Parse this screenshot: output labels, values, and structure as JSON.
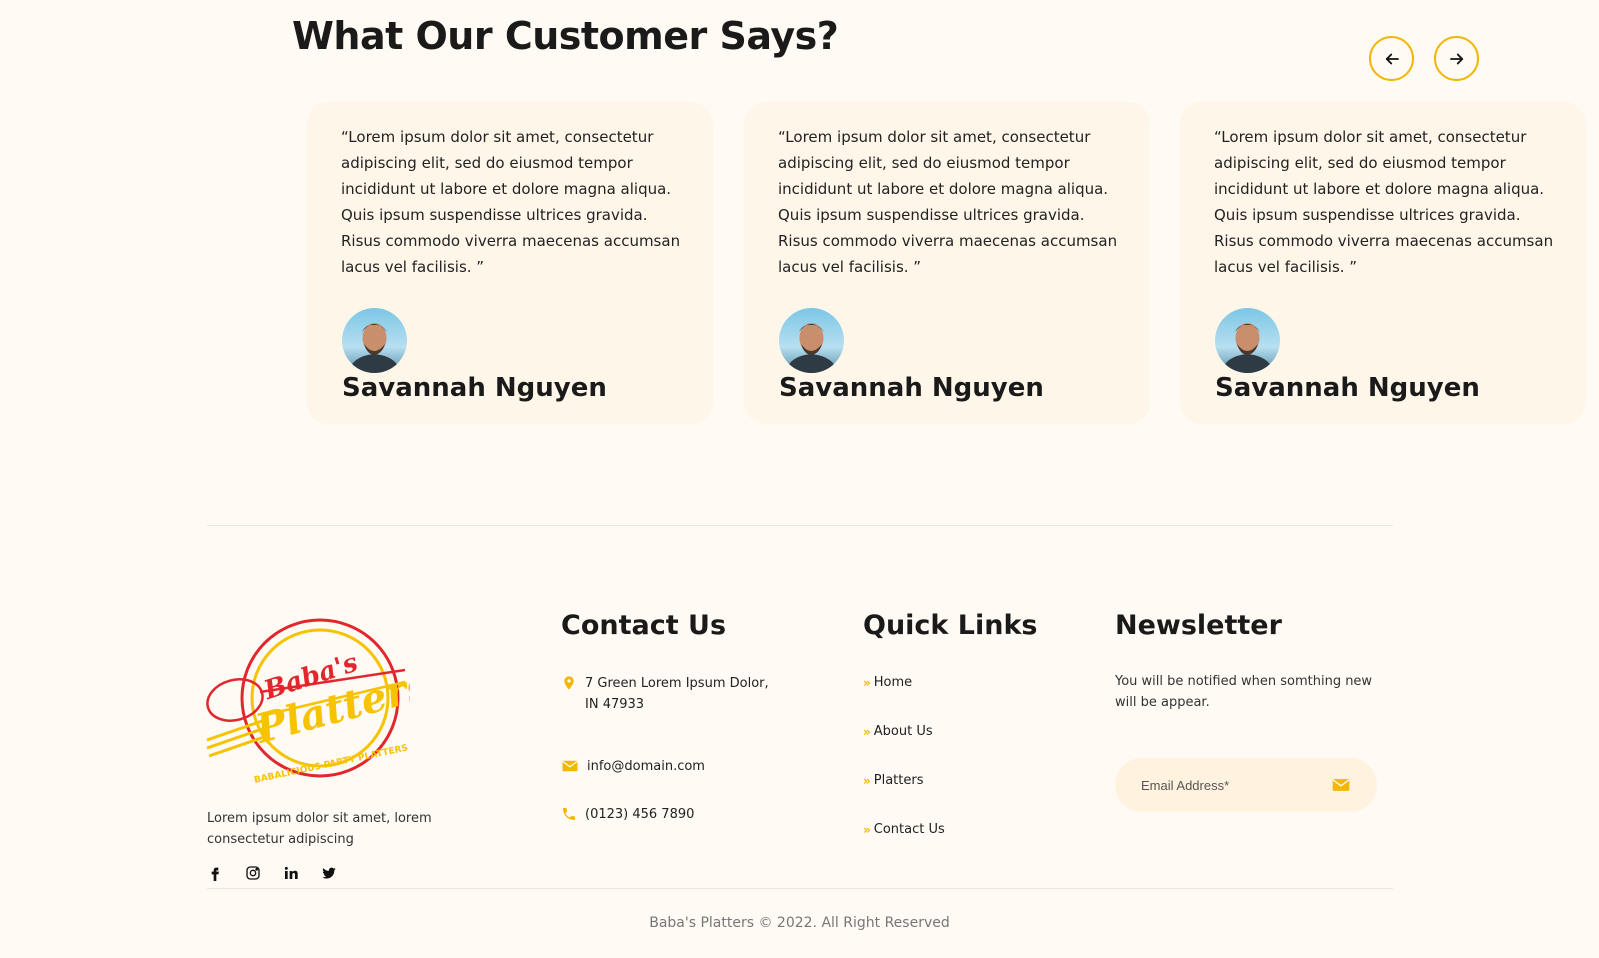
{
  "testimonials": {
    "title": "What Our Customer Says?",
    "prev_icon": "arrow-left-icon",
    "next_icon": "arrow-right-icon",
    "items": [
      {
        "quote": "“Lorem ipsum dolor sit amet, consectetur adipiscing elit, sed do eiusmod tempor incididunt ut labore et dolore magna aliqua. Quis ipsum suspendisse ultrices gravida. Risus commodo viverra maecenas accumsan lacus vel facilisis. ”",
        "name": "Savannah Nguyen"
      },
      {
        "quote": "“Lorem ipsum dolor sit amet, consectetur adipiscing elit, sed do eiusmod tempor incididunt ut labore et dolore magna aliqua. Quis ipsum suspendisse ultrices gravida. Risus commodo viverra maecenas accumsan lacus vel facilisis. ”",
        "name": "Savannah Nguyen"
      },
      {
        "quote": "“Lorem ipsum dolor sit amet, consectetur adipiscing elit, sed do eiusmod tempor incididunt ut labore et dolore magna aliqua. Quis ipsum suspendisse ultrices gravida. Risus commodo viverra maecenas accumsan lacus vel facilisis. ”",
        "name": "Savannah Nguyen"
      }
    ]
  },
  "footer": {
    "logo": {
      "line1": "Baba's",
      "line2": "Platters",
      "ring": "BABALICIOUS PARTY PLATTERS"
    },
    "description": "Lorem ipsum dolor sit amet, lorem consectetur adipiscing",
    "socials": [
      "facebook-icon",
      "instagram-icon",
      "linkedin-icon",
      "twitter-icon"
    ],
    "contact": {
      "title": "Contact Us",
      "address": "7 Green Lorem Ipsum Dolor, IN 47933",
      "email": "info@domain.com",
      "phone": "(0123) 456 7890"
    },
    "quick_links": {
      "title": "Quick Links",
      "items": [
        "Home",
        "About Us",
        "Platters",
        "Contact Us"
      ]
    },
    "newsletter": {
      "title": "Newsletter",
      "text": "You will be notified when somthing new will be appear.",
      "placeholder": "Email Address*",
      "send_icon": "envelope-icon"
    },
    "copyright": "Baba's Platters © 2022. All Right Reserved"
  },
  "colors": {
    "accent": "#f2b705",
    "background": "#fffaf4",
    "card": "#fff6ea",
    "logo_red": "#e3262d"
  }
}
